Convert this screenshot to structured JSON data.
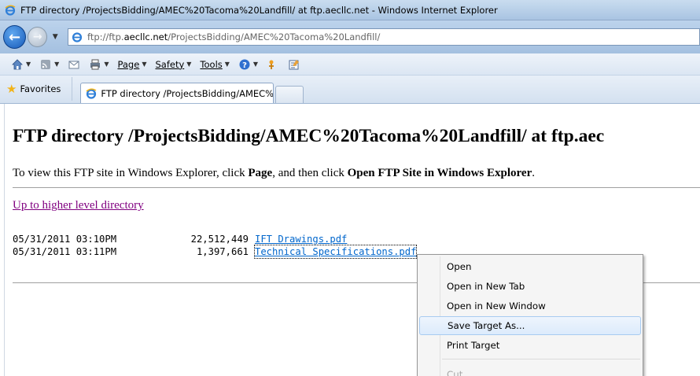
{
  "window": {
    "title": "FTP directory /ProjectsBidding/AMEC%20Tacoma%20Landfill/ at ftp.aecllc.net - Windows Internet Explorer"
  },
  "address": {
    "url_prefix": "ftp://ftp.",
    "url_domain": "aecllc.net",
    "url_path": "/ProjectsBidding/AMEC%20Tacoma%20Landfill/"
  },
  "commandbar": {
    "page_label": "Page",
    "safety_label": "Safety",
    "tools_label": "Tools"
  },
  "favorites": {
    "label": "Favorites"
  },
  "tab": {
    "label": "FTP directory /ProjectsBidding/AMEC%20Tacom..."
  },
  "page": {
    "title": "FTP directory /ProjectsBidding/AMEC%20Tacoma%20Landfill/ at ftp.aec",
    "instructions": {
      "part1": "To view this FTP site in Windows Explorer, click ",
      "bold1": "Page",
      "part2": ", and then click ",
      "bold2": "Open FTP Site in Windows Explorer",
      "part3": "."
    },
    "up_link": "Up to higher level directory",
    "files": [
      {
        "date": "05/31/2011 03:10PM",
        "size": "22,512,449",
        "name": "IFT Drawings.pdf"
      },
      {
        "date": "05/31/2011 03:11PM",
        "size": "1,397,661",
        "name": "Technical Specifications.pdf"
      }
    ]
  },
  "context_menu": {
    "items": [
      {
        "label": "Open"
      },
      {
        "label": "Open in New Tab"
      },
      {
        "label": "Open in New Window"
      },
      {
        "label": "Save Target As..."
      },
      {
        "label": "Print Target"
      },
      {
        "label": "Cut"
      }
    ]
  },
  "colors": {
    "link": "#0066cc",
    "visited_link": "#800080"
  }
}
